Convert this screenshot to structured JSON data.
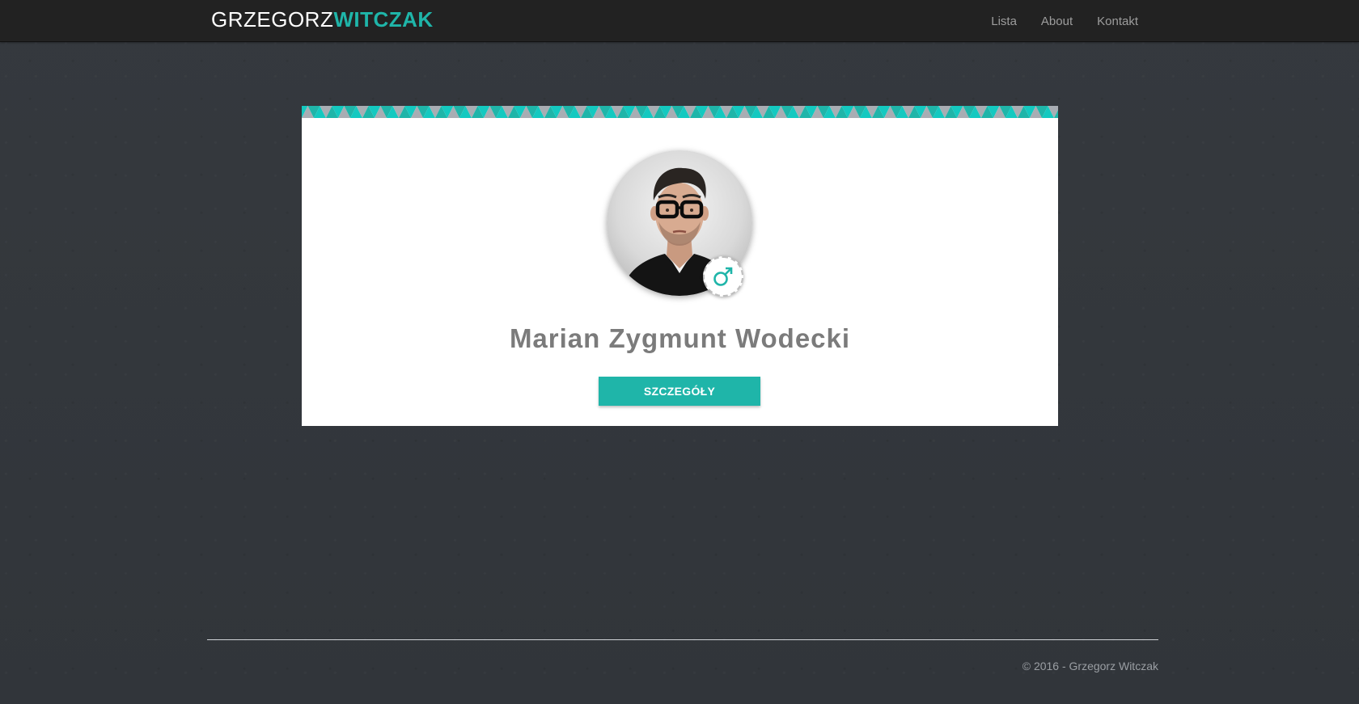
{
  "navbar": {
    "brand_first": "GRZEGORZ",
    "brand_last": "WITCZAK",
    "links": [
      "Lista",
      "About",
      "Kontakt"
    ]
  },
  "profile": {
    "name": "Marian Zygmunt Wodecki",
    "gender_icon": "male-symbol-icon",
    "avatar": "person-avatar-photo",
    "details_label": "SZCZEGÓŁY"
  },
  "footer": {
    "copyright": "© 2016 - Grzegorz Witczak"
  },
  "colors": {
    "accent": "#1fb5a9",
    "navbar_bg": "#222222",
    "page_bg": "#33373c",
    "card_bg": "#ffffff",
    "name_text": "#7b7b7b"
  }
}
